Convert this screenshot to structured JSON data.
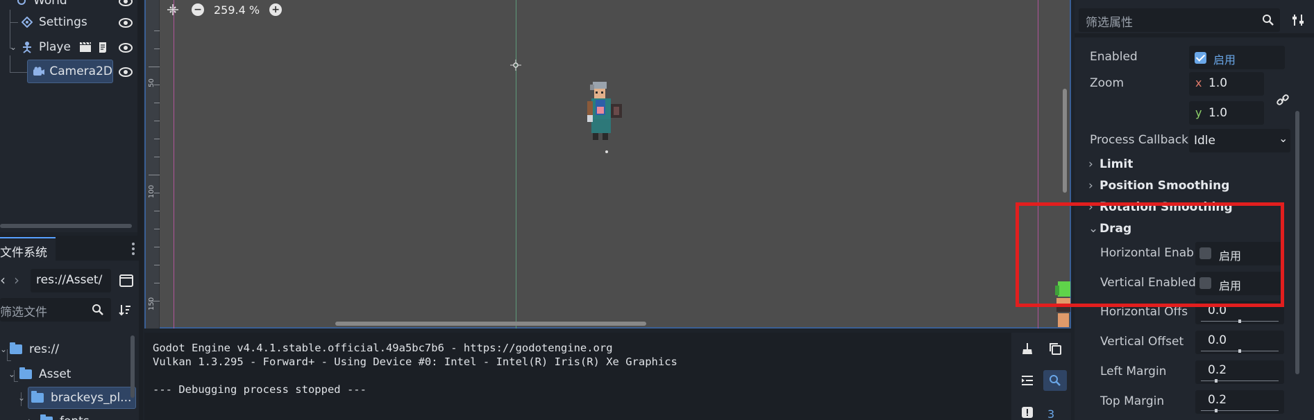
{
  "scene_tree": {
    "rows": [
      {
        "label": "World"
      },
      {
        "label": "Settings"
      },
      {
        "label": "Playe"
      },
      {
        "label": "Camera2D"
      }
    ]
  },
  "filesystem": {
    "tab_label": "文件系统",
    "path": "res://Asset/",
    "filter_placeholder": "筛选文件",
    "items": [
      {
        "label": "res://"
      },
      {
        "label": "Asset"
      },
      {
        "label": "brackeys_pl..."
      },
      {
        "label": "fonts"
      }
    ]
  },
  "viewport": {
    "zoom": "259.4 %",
    "ruler": [
      "50",
      "100",
      "150"
    ]
  },
  "output": {
    "lines": [
      "Godot Engine v4.4.1.stable.official.49a5bc7b6 - https://godotengine.org",
      "Vulkan 1.3.295 - Forward+ - Using Device #0: Intel - Intel(R) Iris(R) Xe Graphics",
      "",
      "--- Debugging process stopped ---"
    ],
    "badge_count": "3"
  },
  "inspector": {
    "filter_placeholder": "筛选属性",
    "enabled": {
      "label": "Enabled",
      "value_text": "启用",
      "checked": true
    },
    "zoom": {
      "label": "Zoom",
      "x_axis": "x",
      "x": "1.0",
      "y_axis": "y",
      "y": "1.0"
    },
    "process_callback": {
      "label": "Process Callback",
      "value": "Idle"
    },
    "sections": {
      "limit": "Limit",
      "position_smoothing": "Position Smoothing",
      "rotation_smoothing": "Rotation Smoothing",
      "drag": "Drag"
    },
    "drag": {
      "horizontal_enabled": {
        "label": "Horizontal Enab",
        "value_text": "启用",
        "checked": false
      },
      "vertical_enabled": {
        "label": "Vertical Enabled",
        "value_text": "启用",
        "checked": false
      },
      "horizontal_offset": {
        "label": "Horizontal Offs",
        "value": "0.0",
        "level": 0.5
      },
      "vertical_offset": {
        "label": "Vertical Offset",
        "value": "0.0",
        "level": 0.5
      },
      "left_margin": {
        "label": "Left Margin",
        "value": "0.2",
        "level": 0.2
      },
      "top_margin": {
        "label": "Top Margin",
        "value": "0.2",
        "level": 0.2
      }
    }
  },
  "colors": {
    "accent": "#57a0ff",
    "highlight_box": "#e21e1e"
  }
}
